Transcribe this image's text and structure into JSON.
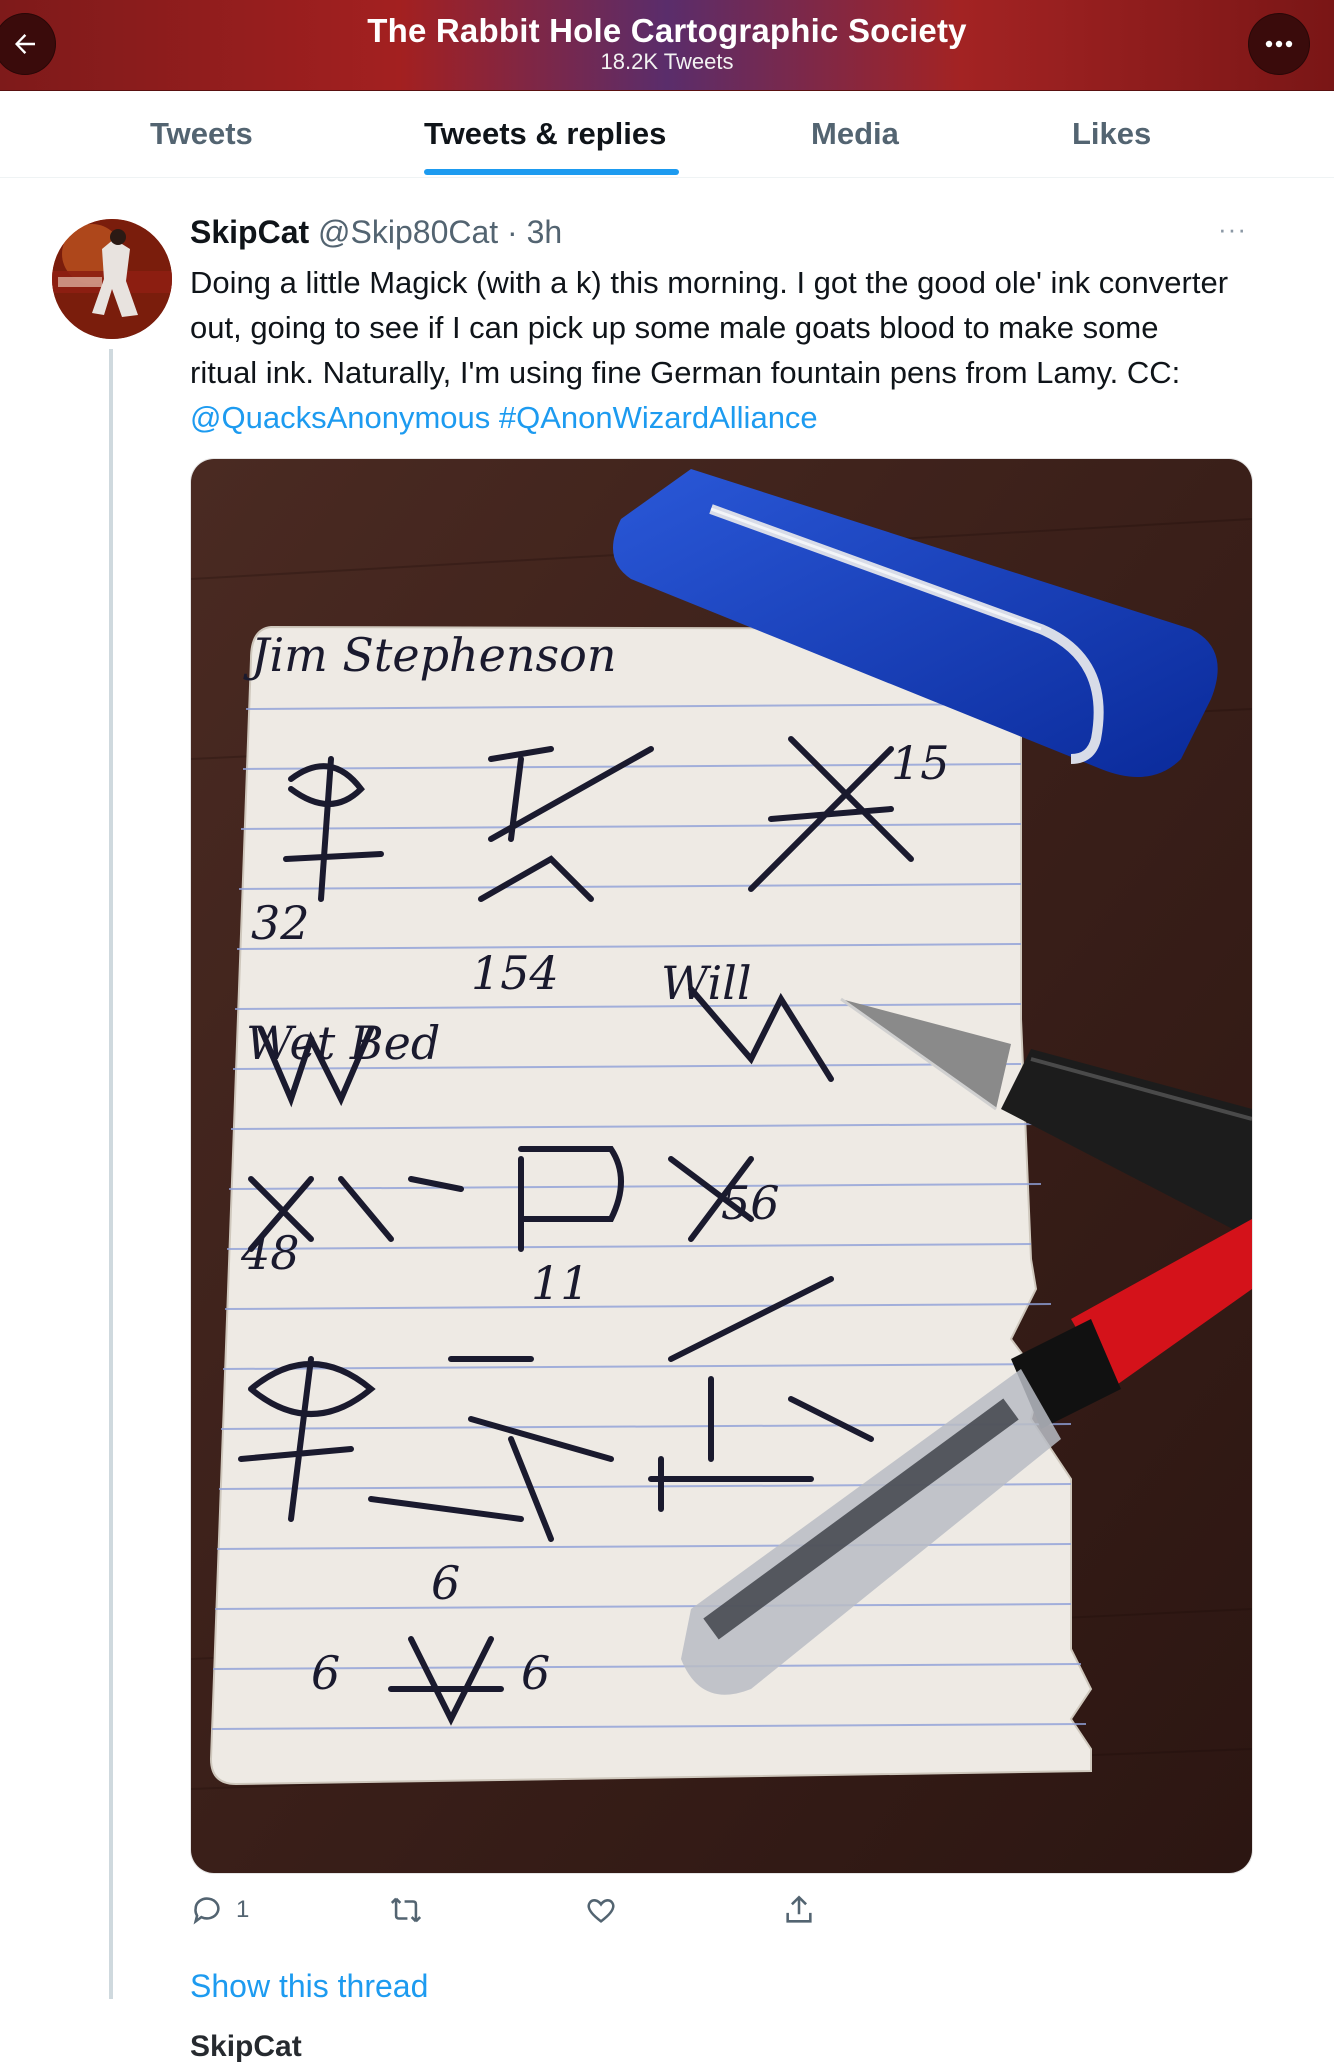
{
  "header": {
    "title": "The Rabbit Hole Cartographic Society",
    "subtitle": "18.2K Tweets",
    "back_icon": "arrow-left-icon",
    "more_icon": "more-horizontal-icon"
  },
  "tabs": [
    {
      "label": "Tweets",
      "active": false
    },
    {
      "label": "Tweets & replies",
      "active": true
    },
    {
      "label": "Media",
      "active": false
    },
    {
      "label": "Likes",
      "active": false
    }
  ],
  "tweet": {
    "name": "SkipCat",
    "handle": "@Skip80Cat",
    "separator": "·",
    "time": "3h",
    "more": "···",
    "text_1": "Doing a little Magick (with a k) this morning. I got the good ole' ink converter out, going to see if I can pick up some male goats blood to make some ritual ink. Naturally, I'm using fine German fountain pens from Lamy. CC: ",
    "mention": "@QuacksAnonymous",
    "hashtag": "#QAnonWizardAlliance",
    "media": {
      "heading": "Jim Stephenson",
      "numbers": [
        "15",
        "32",
        "154",
        "48",
        "11",
        "56",
        "6",
        "6",
        "6"
      ],
      "words": [
        "Wet Bed",
        "Will"
      ]
    },
    "actions": {
      "reply_count": "1",
      "retweet_count": "",
      "like_count": ""
    },
    "show_thread": "Show this thread"
  },
  "next_tweet": {
    "partial_name": "SkipCat"
  },
  "colors": {
    "accent": "#1d9bf0",
    "header_red": "#a32020",
    "muted_text": "#536471"
  }
}
